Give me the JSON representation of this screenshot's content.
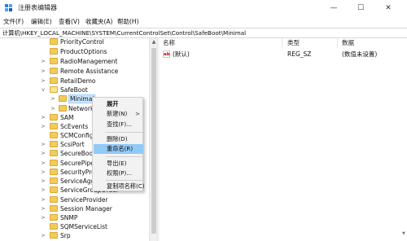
{
  "window": {
    "title": "注册表编辑器",
    "minimize_glyph": "—",
    "maximize_glyph": "☐",
    "close_glyph": "✕"
  },
  "menu": [
    "文件(F)",
    "编辑(E)",
    "查看(V)",
    "收藏夹(A)",
    "帮助(H)"
  ],
  "address": "计算机\\HKEY_LOCAL_MACHINE\\SYSTEM\\CurrentControlSet\\Control\\SafeBoot\\Minimal",
  "tree": {
    "items": [
      {
        "label": "PriorityControl",
        "arrow": ""
      },
      {
        "label": "ProductOptions",
        "arrow": ""
      },
      {
        "label": "RadioManagement",
        "arrow": ">"
      },
      {
        "label": "Remote Assistance",
        "arrow": ">"
      },
      {
        "label": "RetailDemo",
        "arrow": ">"
      },
      {
        "label": "SafeBoot",
        "arrow": "v"
      },
      {
        "label": "Minimal",
        "arrow": ">"
      },
      {
        "label": "Network",
        "arrow": ">"
      },
      {
        "label": "SAM",
        "arrow": ">"
      },
      {
        "label": "ScEvents",
        "arrow": ">"
      },
      {
        "label": "SCMConfig",
        "arrow": ""
      },
      {
        "label": "ScsiPort",
        "arrow": ">"
      },
      {
        "label": "SecureBoot",
        "arrow": ">"
      },
      {
        "label": "SecurePipe",
        "arrow": ">"
      },
      {
        "label": "SecurityPro",
        "arrow": ">"
      },
      {
        "label": "ServiceAgg",
        "arrow": ">"
      },
      {
        "label": "ServiceGroupOrder",
        "arrow": ">"
      },
      {
        "label": "ServiceProvider",
        "arrow": ">"
      },
      {
        "label": "Session Manager",
        "arrow": ">"
      },
      {
        "label": "SNMP",
        "arrow": ">"
      },
      {
        "label": "SQMServiceList",
        "arrow": ""
      },
      {
        "label": "Srp",
        "arrow": ">"
      }
    ]
  },
  "list": {
    "headers": {
      "name": "名称",
      "type": "类型",
      "data": "数据"
    },
    "rows": [
      {
        "name": "(默认)",
        "type": "REG_SZ",
        "data": "(数值未设置)",
        "icon": "ab"
      }
    ]
  },
  "context_menu": {
    "items": [
      {
        "label": "展开",
        "bold": true,
        "submenu": ""
      },
      {
        "label": "新建(N)",
        "bold": false,
        "submenu": ">"
      },
      {
        "label": "查找(F)...",
        "bold": false,
        "submenu": ""
      },
      {
        "label": "删除(D)",
        "bold": false,
        "submenu": ""
      },
      {
        "label": "重命名(R)",
        "bold": false,
        "submenu": "",
        "highlighted": true
      },
      {
        "label": "导出(E)",
        "bold": false,
        "submenu": ""
      },
      {
        "label": "权限(P)...",
        "bold": false,
        "submenu": ""
      },
      {
        "label": "复制项名称(C)",
        "bold": false,
        "submenu": ""
      }
    ]
  },
  "colors": {
    "selection": "#cce8ff",
    "menu_highlight": "#91c9f7",
    "folder": "#f2cb5c"
  }
}
